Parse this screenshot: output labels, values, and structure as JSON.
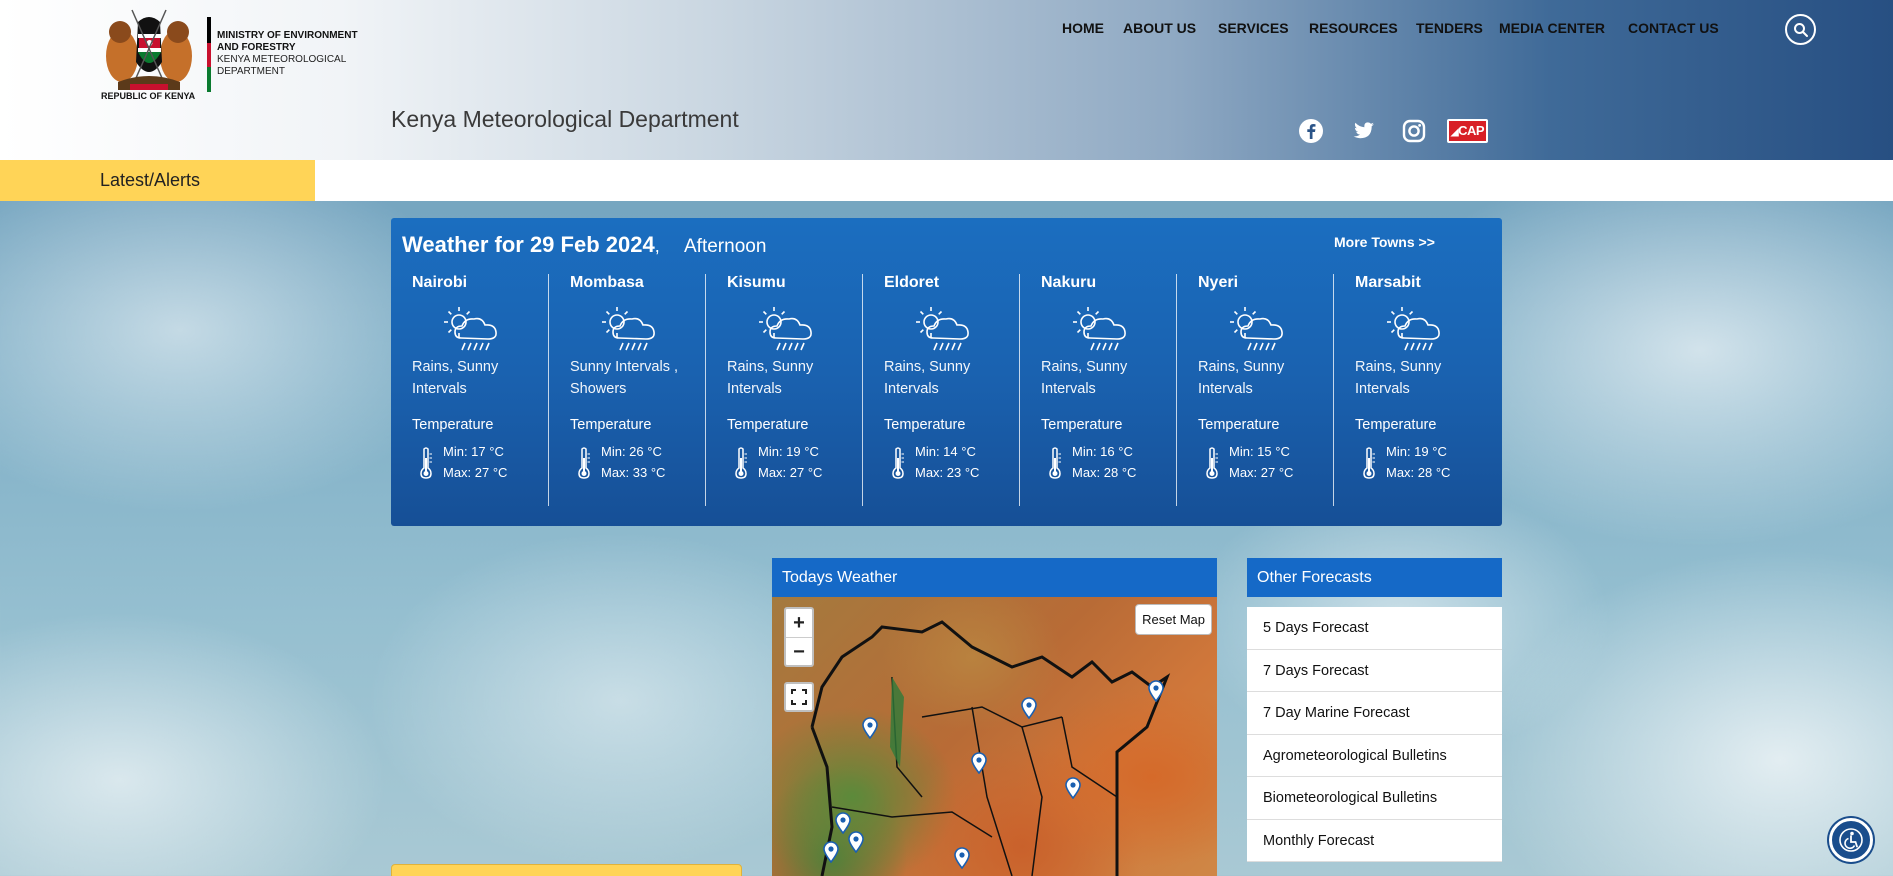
{
  "header": {
    "logo_caption": "REPUBLIC OF KENYA",
    "ministry_line1": "MINISTRY OF ENVIRONMENT AND FORESTRY",
    "ministry_line2": "KENYA METEOROLOGICAL DEPARTMENT",
    "site_title": "Kenya Meteorological Department"
  },
  "nav": {
    "home": "HOME",
    "about": "ABOUT US",
    "services": "SERVICES",
    "resources": "RESOURCES",
    "tenders": "TENDERS",
    "media": "MEDIA CENTER",
    "contact": "CONTACT US"
  },
  "social": {
    "icons": [
      "facebook-icon",
      "twitter-icon",
      "instagram-icon",
      "cap-icon"
    ],
    "cap_label": "CAP"
  },
  "alerts": {
    "label": "Latest/Alerts"
  },
  "weather": {
    "title": "Weather for 29 Feb 2024",
    "separator": ",",
    "period": "Afternoon",
    "more_towns": "More Towns >>",
    "temp_label": "Temperature",
    "towns": [
      {
        "name": "Nairobi",
        "condition": "Rains, Sunny Intervals",
        "min": "Min: 17 °C",
        "max": "Max: 27 °C"
      },
      {
        "name": "Mombasa",
        "condition": "Sunny Intervals , Showers",
        "min": "Min: 26 °C",
        "max": "Max: 33 °C"
      },
      {
        "name": "Kisumu",
        "condition": "Rains, Sunny Intervals",
        "min": "Min: 19 °C",
        "max": "Max: 27 °C"
      },
      {
        "name": "Eldoret",
        "condition": "Rains, Sunny Intervals",
        "min": "Min: 14 °C",
        "max": "Max: 23 °C"
      },
      {
        "name": "Nakuru",
        "condition": "Rains, Sunny Intervals",
        "min": "Min: 16 °C",
        "max": "Max: 28 °C"
      },
      {
        "name": "Nyeri",
        "condition": "Rains, Sunny Intervals",
        "min": "Min: 15 °C",
        "max": "Max: 27 °C"
      },
      {
        "name": "Marsabit",
        "condition": "Rains, Sunny Intervals",
        "min": "Min: 19 °C",
        "max": "Max: 28 °C"
      }
    ]
  },
  "map": {
    "title": "Todays Weather",
    "reset_label": "Reset Map",
    "zoom_in": "+",
    "zoom_out": "−"
  },
  "forecasts": {
    "title": "Other Forecasts",
    "items": [
      "5 Days Forecast",
      "7 Days Forecast",
      "7 Day Marine Forecast",
      "Agrometeorological Bulletins",
      "Biometeorological Bulletins",
      "Monthly Forecast"
    ]
  },
  "colors": {
    "accent_blue": "#1569c7",
    "alert_yellow": "#ffd457",
    "kenya_red": "#c8102e",
    "kenya_green": "#0a7a2f"
  }
}
